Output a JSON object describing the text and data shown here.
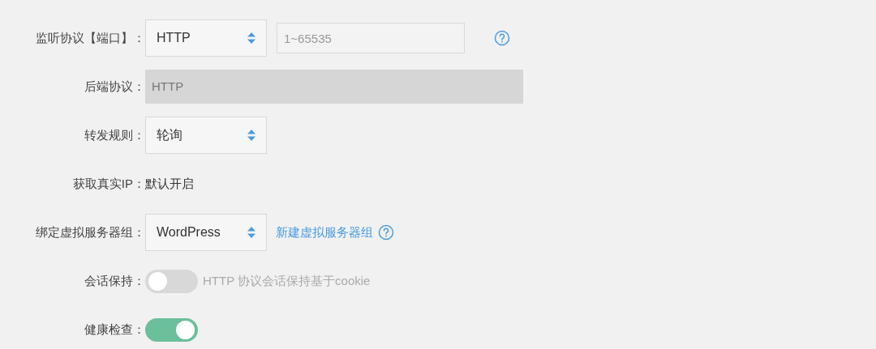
{
  "rows": [
    {
      "kind": "select_port",
      "label": "监听协议【端口】：",
      "value": "HTTP",
      "port_placeholder": "1~65535",
      "help": true
    },
    {
      "kind": "readonly",
      "label": "后端协议：",
      "value": "HTTP"
    },
    {
      "kind": "select",
      "label": "转发规则：",
      "value": "轮询"
    },
    {
      "kind": "text",
      "label": "获取真实IP：",
      "value": "默认开启"
    },
    {
      "kind": "select_link",
      "label": "绑定虚拟服务器组：",
      "value": "WordPress",
      "link": "新建虚拟服务器组",
      "help": true
    },
    {
      "kind": "toggle",
      "label": "会话保持：",
      "on": false,
      "hint": "HTTP 协议会话保持基于cookie"
    },
    {
      "kind": "toggle",
      "label": "健康检查：",
      "on": true
    }
  ]
}
